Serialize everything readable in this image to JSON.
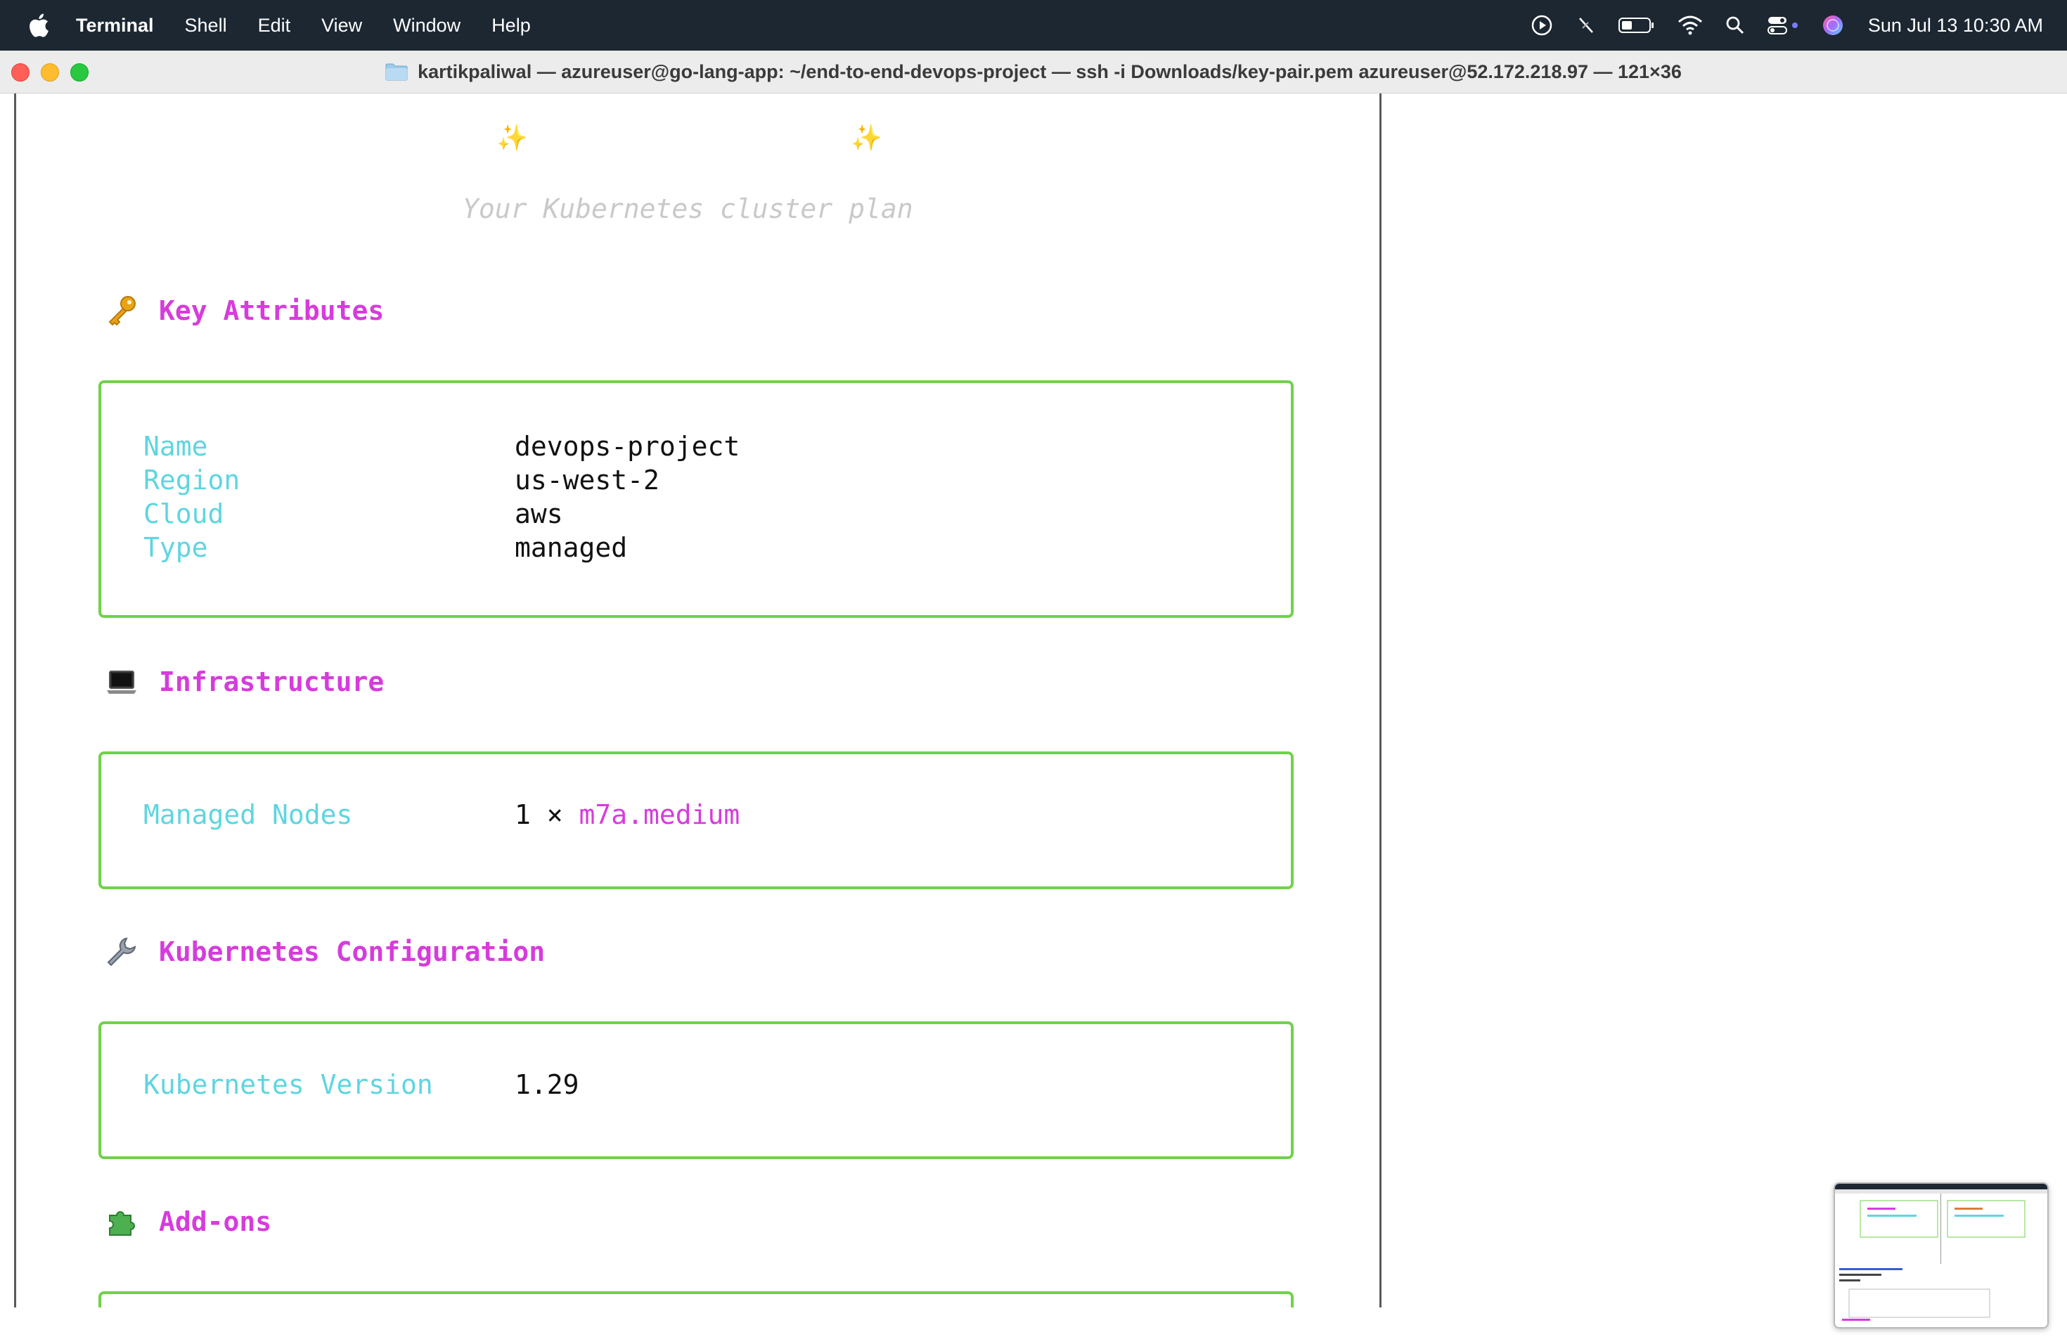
{
  "menubar": {
    "app_name": "Terminal",
    "items": [
      "Shell",
      "Edit",
      "View",
      "Window",
      "Help"
    ],
    "clock": "Sun Jul 13  10:30 AM",
    "status_icons": [
      "screen-record-icon",
      "muted-pen-icon",
      "battery-icon",
      "wifi-icon",
      "spotlight-search-icon",
      "control-center-icon",
      "siri-icon"
    ]
  },
  "window": {
    "title": "kartikpaliwal — azureuser@go-lang-app: ~/end-to-end-devops-project — ssh -i Downloads/key-pair.pem azureuser@52.172.218.97 — 121×36"
  },
  "terminal": {
    "sparkle_left": "✨",
    "sparkle_right": "✨",
    "subtitle": "Your Kubernetes cluster plan",
    "sections": {
      "key_attributes": {
        "title": "Key Attributes",
        "icon": "key-icon",
        "rows": [
          {
            "key": "Name",
            "value": "devops-project"
          },
          {
            "key": "Region",
            "value": "us-west-2"
          },
          {
            "key": "Cloud",
            "value": "aws"
          },
          {
            "key": "Type",
            "value": "managed"
          }
        ]
      },
      "infrastructure": {
        "title": "Infrastructure",
        "icon": "laptop-icon",
        "rows": [
          {
            "key": "Managed Nodes",
            "value_prefix": "1 × ",
            "value_highlight": "m7a.medium"
          }
        ]
      },
      "kubernetes_configuration": {
        "title": "Kubernetes Configuration",
        "icon": "wrench-icon",
        "rows": [
          {
            "key": "Kubernetes Version",
            "value": "1.29"
          }
        ]
      },
      "addons": {
        "title": "Add-ons",
        "icon": "puzzle-piece-icon"
      }
    }
  },
  "colors": {
    "menubar_bg": "#1c2732",
    "heading": "#d63cdc",
    "key": "#5fd5e0",
    "box_border": "#6fd24a",
    "subtitle": "#c9c9c9"
  }
}
